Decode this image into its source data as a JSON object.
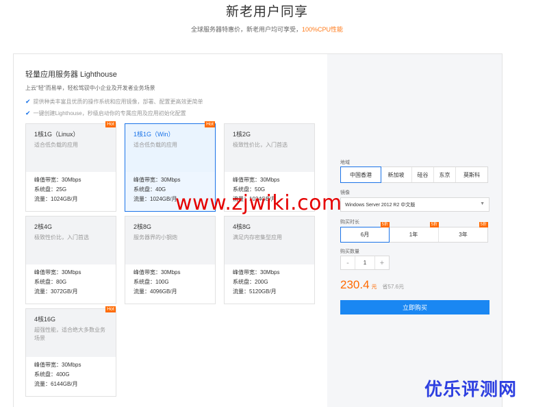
{
  "hero": {
    "title": "新老用户同享",
    "subtitle_prefix": "全球服务器特惠价，新老用户均可享受，",
    "subtitle_highlight": "100%CPU性能"
  },
  "product": {
    "title": "轻量应用服务器 Lighthouse",
    "tagline": "上云\"轻\"而易举，轻松驾驭中小企业及开发者业务场景",
    "features": [
      "提供种类丰富且优质的操作系统和应用镜像，部署、配置更高效更简单",
      "一键创建Lighthouse，秒级启动你的专属应用及应用初始化配置"
    ]
  },
  "spec_labels": {
    "bandwidth": "峰值带宽：",
    "disk": "系统盘：",
    "traffic": "流量："
  },
  "plans": [
    {
      "name": "1核1G（Linux）",
      "desc": "适合低负载的应用",
      "bandwidth": "30Mbps",
      "disk": "25G",
      "traffic": "1024GB/月",
      "hot": "Hot",
      "selected": false
    },
    {
      "name": "1核1G（Win）",
      "desc": "适合低负载的应用",
      "bandwidth": "30Mbps",
      "disk": "40G",
      "traffic": "1024GB/月",
      "hot": "Hot",
      "selected": true
    },
    {
      "name": "1核2G",
      "desc": "极致性价比，入门首选",
      "bandwidth": "30Mbps",
      "disk": "50G",
      "traffic": "1024GB/月",
      "hot": "",
      "selected": false
    },
    {
      "name": "2核4G",
      "desc": "极致性价比，入门首选",
      "bandwidth": "30Mbps",
      "disk": "80G",
      "traffic": "3072GB/月",
      "hot": "",
      "selected": false
    },
    {
      "name": "2核8G",
      "desc": "服务器界的小钢炮",
      "bandwidth": "30Mbps",
      "disk": "100G",
      "traffic": "4096GB/月",
      "hot": "",
      "selected": false
    },
    {
      "name": "4核8G",
      "desc": "满足内存密集型应用",
      "bandwidth": "30Mbps",
      "disk": "200G",
      "traffic": "5120GB/月",
      "hot": "",
      "selected": false
    },
    {
      "name": "4核16G",
      "desc": "超强性能，适合绝大多数业务场景",
      "bandwidth": "30Mbps",
      "disk": "400G",
      "traffic": "6144GB/月",
      "hot": "Hot",
      "selected": false
    }
  ],
  "config": {
    "region_label": "地域",
    "regions": [
      "中国香港",
      "新加坡",
      "硅谷",
      "东京",
      "莫斯科"
    ],
    "region_selected": "中国香港",
    "image_label": "镜像",
    "image_value": "Windows Server 2012 R2 中文版",
    "duration_label": "购买时长",
    "durations": [
      {
        "label": "6月",
        "badge": "5折",
        "active": true
      },
      {
        "label": "1年",
        "badge": "5折",
        "active": false
      },
      {
        "label": "3年",
        "badge": "5折",
        "active": false
      }
    ],
    "quantity_label": "购买数量",
    "quantity": "1",
    "minus": "-",
    "plus": "+",
    "price": "230.4",
    "price_unit": "元",
    "savings": "省57.6元",
    "buy_label": "立即购买"
  },
  "watermark": "www.zjwiki.com",
  "logo_text": "优乐评测网",
  "colors": {
    "accent": "#1a73e8",
    "orange": "#ff6a00",
    "watermark": "#e50000",
    "logo": "#2d3fe0"
  }
}
